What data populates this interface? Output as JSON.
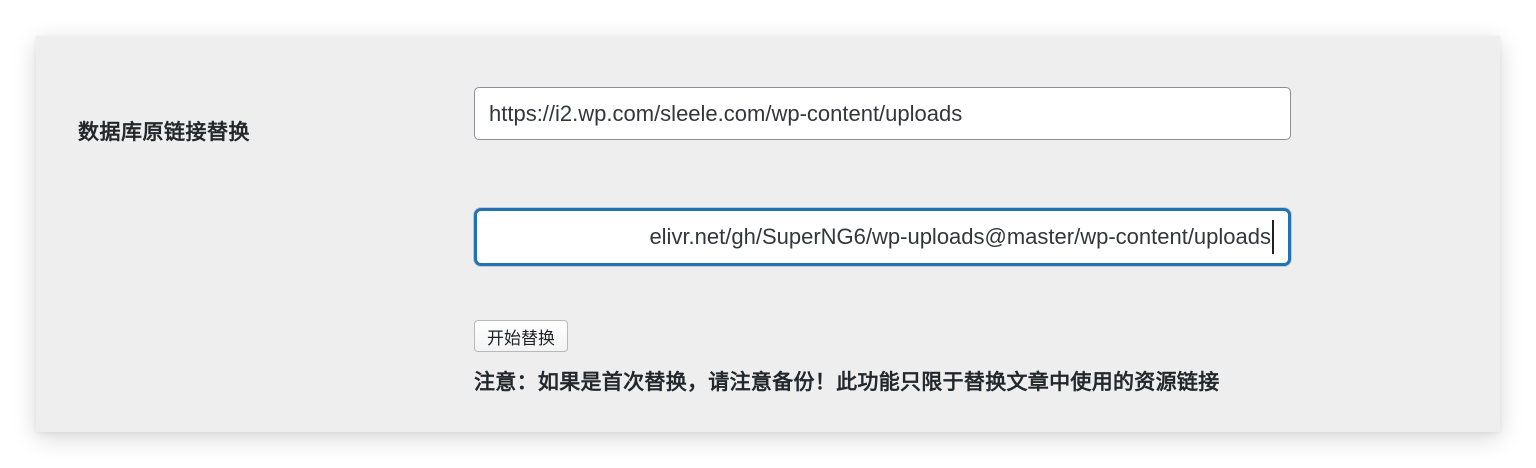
{
  "form": {
    "row_label": "数据库原链接替换",
    "source_input_value": "https://i2.wp.com/sleele.com/wp-content/uploads",
    "target_input_value": "elivr.net/gh/SuperNG6/wp-uploads@master/wp-content/uploads",
    "submit_label": "开始替换",
    "notice_text": "注意：如果是首次替换，请注意备份！此功能只限于替换文章中使用的资源链接"
  },
  "colors": {
    "panel_background": "#eeeeee",
    "focus_border": "#2271b1",
    "text": "#23282d"
  }
}
